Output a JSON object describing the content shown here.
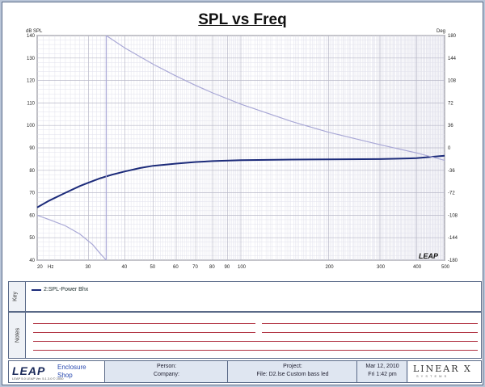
{
  "chart_title": "SPL vs Freq",
  "chart_data": {
    "type": "line",
    "title": "SPL vs Freq",
    "xlabel": "Hz",
    "ylabel_left": "dB SPL",
    "ylabel_right": "Deg",
    "x_scale": "log",
    "xlim": [
      20,
      500
    ],
    "ylim_left": [
      40,
      140
    ],
    "ylim_right": [
      -180,
      180
    ],
    "x_ticks": [
      "20",
      "30",
      "40",
      "50",
      "60",
      "70",
      "80",
      "90",
      "100",
      "200",
      "300",
      "400",
      "500"
    ],
    "y_ticks_left": [
      "140",
      "130",
      "120",
      "110",
      "100",
      "90",
      "80",
      "70",
      "60",
      "50",
      "40"
    ],
    "y_ticks_right": [
      "180",
      "144",
      "108",
      "72",
      "36",
      "0",
      "-36",
      "-72",
      "-108",
      "-144",
      "-180"
    ],
    "grid": true,
    "series": [
      {
        "name": "2:SPL-Power Bhx",
        "axis": "left",
        "color": "#1c2b7a",
        "x": [
          20,
          22,
          25,
          28,
          30,
          33,
          36,
          40,
          45,
          50,
          60,
          70,
          80,
          100,
          150,
          200,
          300,
          400,
          500
        ],
        "y": [
          63.5,
          66.5,
          70,
          73,
          74.5,
          76.5,
          78,
          79.5,
          81,
          82,
          83,
          83.7,
          84.1,
          84.5,
          84.8,
          84.9,
          85,
          85.4,
          86.5
        ]
      },
      {
        "name": "",
        "axis": "right",
        "color": "#a9a8d6",
        "x": [
          34.5,
          40,
          50,
          60,
          70,
          80,
          100,
          150,
          200,
          300,
          400,
          500
        ],
        "y": [
          180,
          160,
          134,
          115,
          100,
          88,
          70,
          42,
          25,
          5,
          -8,
          -20
        ]
      },
      {
        "name": "",
        "axis": "right",
        "color": "#a9a8d6",
        "x": [
          20,
          22,
          25,
          28,
          31,
          33,
          34.5
        ],
        "y": [
          -108,
          -115,
          -125,
          -138,
          -155,
          -170,
          -180
        ]
      }
    ],
    "annotation": "LEAP"
  },
  "legend": {
    "side_label": "Key",
    "entry": "2:SPL-Power Bhx"
  },
  "notes": {
    "side_label": "Notes"
  },
  "footer": {
    "logo": "LEAP",
    "logo_sub": "LEAP 5.0 LEAP Ver. 5.1.3.0 © 2000",
    "product_line1": "Enclosure",
    "product_line2": "Shop",
    "person_label": "Person:",
    "company_label": "Company:",
    "project_label": "Project:",
    "file_label": "File: D2.lse Custom bass led",
    "date": "Mar 12, 2010",
    "time": "Fri  1:42 pm",
    "brand": "LINEAR X",
    "brand_sub": "SYSTEMS"
  }
}
